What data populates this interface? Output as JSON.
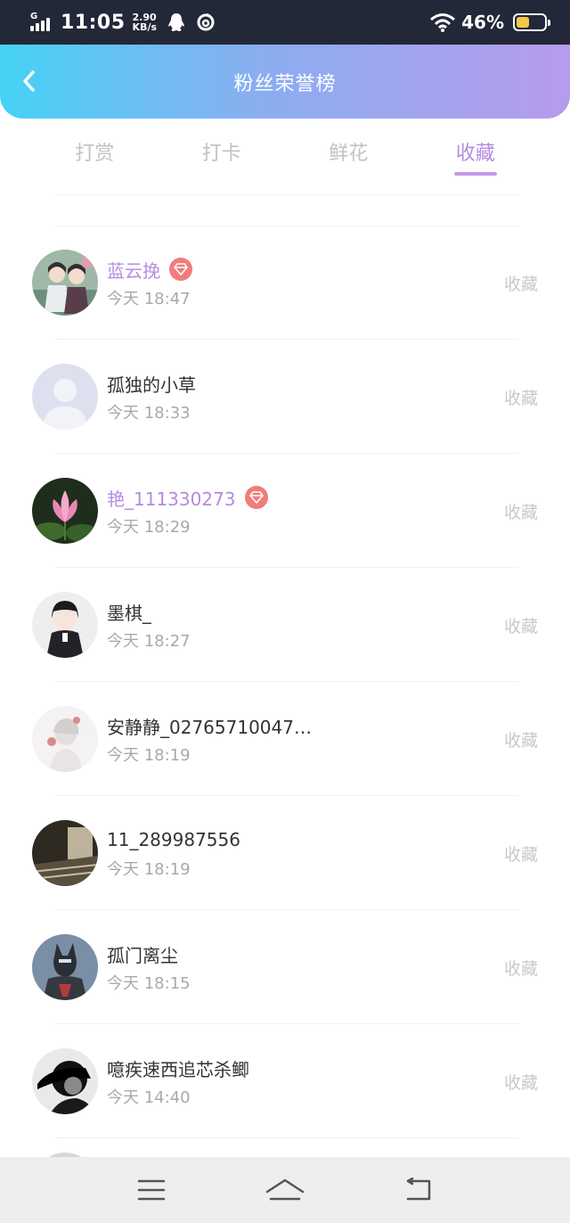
{
  "status_bar": {
    "network": "G",
    "time": "11:05",
    "speed_value": "2.90",
    "speed_unit": "KB/s",
    "battery_percent": "46%",
    "icons": [
      "signal-icon",
      "qq-icon",
      "netease-music-icon",
      "wifi-icon",
      "battery-icon"
    ]
  },
  "header": {
    "title": "粉丝荣誉榜",
    "back_icon": "chevron-left-icon"
  },
  "tabs": [
    {
      "label": "打赏",
      "active": false
    },
    {
      "label": "打卡",
      "active": false
    },
    {
      "label": "鲜花",
      "active": false
    },
    {
      "label": "收藏",
      "active": true
    }
  ],
  "list": [
    {
      "name": "蓝云挽",
      "time": "今天 18:47",
      "action": "收藏",
      "vip": true
    },
    {
      "name": "孤独的小草",
      "time": "今天 18:33",
      "action": "收藏",
      "vip": false
    },
    {
      "name": "艳_111330273",
      "time": "今天 18:29",
      "action": "收藏",
      "vip": true
    },
    {
      "name": "墨棋_",
      "time": "今天 18:27",
      "action": "收藏",
      "vip": false
    },
    {
      "name": "安静静_02765710047…",
      "time": "今天 18:19",
      "action": "收藏",
      "vip": false
    },
    {
      "name": "11_289987556",
      "time": "今天 18:19",
      "action": "收藏",
      "vip": false
    },
    {
      "name": "孤门离尘",
      "time": "今天 18:15",
      "action": "收藏",
      "vip": false
    },
    {
      "name": "噫疾速西追芯杀鲫",
      "time": "今天 14:40",
      "action": "收藏",
      "vip": false
    }
  ],
  "colors": {
    "accent": "#b58be0",
    "badge": "#f37b7b",
    "header_gradient_start": "#46d2f5",
    "header_gradient_end": "#b79bee"
  },
  "nav": [
    "menu-icon",
    "home-icon",
    "back-icon"
  ]
}
